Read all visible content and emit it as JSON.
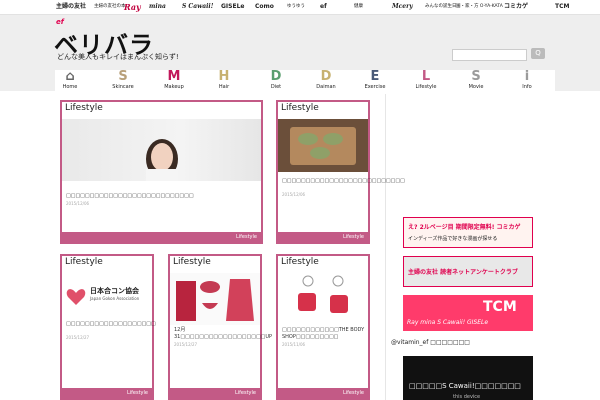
{
  "topbar": {
    "brands": [
      "主婦の友社",
      "主婦の友社の本",
      "Ray",
      "mina",
      "S Cawaii!",
      "GISELe",
      "Como",
      "ゆうゆう",
      "ef",
      "健康",
      "Mcery",
      "みんなの誕生日",
      "園・家・方 O-YA-KATA",
      "コミカゲ",
      "TCM"
    ]
  },
  "header": {
    "logo_small": "ef",
    "logo": "ベリバラ",
    "tagline": "どんな美人もキレイはまんぷく知らず!",
    "search_placeholder": "",
    "search_button": "Q"
  },
  "nav": [
    {
      "glyph": "⌂",
      "label": "Home",
      "color": "#666666"
    },
    {
      "glyph": "S",
      "label": "Skincare",
      "color": "#b8a07a"
    },
    {
      "glyph": "M",
      "label": "Makeup",
      "color": "#c1185b"
    },
    {
      "glyph": "H",
      "label": "Hair",
      "color": "#c7b170"
    },
    {
      "glyph": "D",
      "label": "Diet",
      "color": "#5a9e6f"
    },
    {
      "glyph": "D",
      "label": "Daiman",
      "color": "#c7b170"
    },
    {
      "glyph": "E",
      "label": "Exercise",
      "color": "#4a5a78"
    },
    {
      "glyph": "L",
      "label": "Lifestyle",
      "color": "#c35a86"
    },
    {
      "glyph": "S",
      "label": "Movie",
      "color": "#9b9b9b"
    },
    {
      "glyph": "i",
      "label": "Info",
      "color": "#9b9b9b"
    }
  ],
  "cards": [
    {
      "category": "Lifestyle",
      "title": "□□□□□□□□□□□□□□□□□□□□□□□□□□□",
      "date": "2015/12/06",
      "footer": "Lifestyle"
    },
    {
      "category": "Lifestyle",
      "title": "□□□□□□□□□□□□□□□□□□□□□□□□□□",
      "date": "2015/12/06",
      "footer": "Lifestyle"
    },
    {
      "category": "Lifestyle",
      "title": "□□□□□□□□□□□□□□□□□□□",
      "date": "2015/12/27",
      "footer": "Lifestyle"
    },
    {
      "category": "Lifestyle",
      "title": "12月31□□□□□□□□□□□□□□□□□□UP",
      "date": "2015/12/27",
      "footer": "Lifestyle"
    },
    {
      "category": "Lifestyle",
      "title": "□□□□□□□□□□□□THE BODY SHOP□□□□□□□□□",
      "date": "2015/11/06",
      "footer": "Lifestyle"
    }
  ],
  "heart_org": {
    "jp": "日本合コン協会",
    "en": "Japan Gokon Association"
  },
  "sidebar": {
    "banner1": "え? 2ルページ目 期間限定無料! コミカゲ",
    "banner1_sub": "インディーズ作品で好きな漫画が探せる",
    "banner2": "主婦の友社 読者ネットアンケートクラブ",
    "banner3": "TCM",
    "banner3_sub": "Ray mina S Cawaii! GISELe",
    "twitter": "@vitamin_ef □□□□□□□",
    "video_title": "□□□□□S Cawaii!□□□□□□□",
    "video_sub": "this device"
  }
}
